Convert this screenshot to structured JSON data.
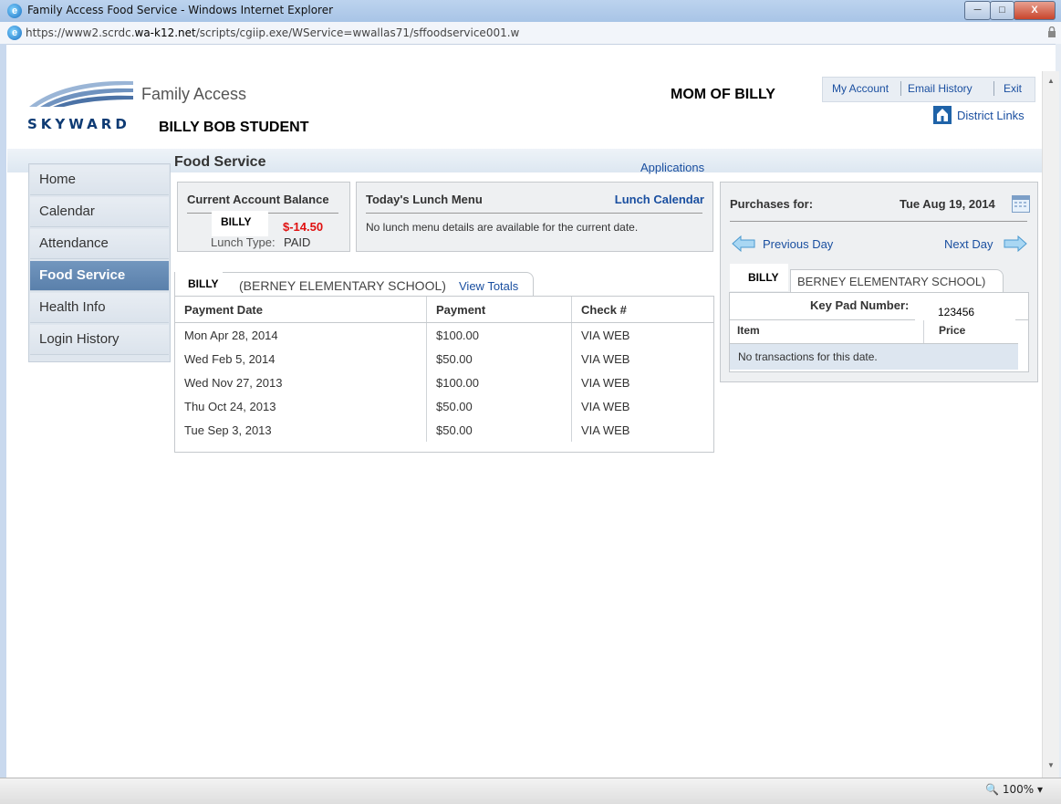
{
  "window": {
    "title": "Family Access Food Service - Windows Internet Explorer",
    "url_prefix": "https://www2.scrdc.",
    "url_domain": "wa-k12.net",
    "url_path": "/scripts/cgiip.exe/WService=wwallas71/sffoodservice001.w",
    "zoom": "100%"
  },
  "header": {
    "logo_text": "SKYWARD",
    "app_name": "Family Access",
    "student_name": "BILLY BOB STUDENT",
    "parent_name": "MOM OF BILLY",
    "links": [
      "My Account",
      "Email History",
      "Exit"
    ],
    "district_links": "District Links"
  },
  "sidebar": {
    "items": [
      {
        "label": "Home"
      },
      {
        "label": "Calendar"
      },
      {
        "label": "Attendance"
      },
      {
        "label": "Food Service"
      },
      {
        "label": "Health Info"
      },
      {
        "label": "Login History"
      }
    ]
  },
  "main": {
    "title": "Food Service",
    "applications": "Applications",
    "balance": {
      "heading": "Current Account Balance",
      "name": "BILLY",
      "amount": "$-14.50",
      "lunch_type_label": "Lunch Type:",
      "lunch_type_value": "PAID"
    },
    "menu": {
      "heading": "Today's Lunch Menu",
      "calendar_link": "Lunch Calendar",
      "message": "No lunch menu details are available for the current date."
    },
    "tab": {
      "name": "BILLY",
      "school": "(BERNEY ELEMENTARY SCHOOL)",
      "view_totals": "View Totals"
    },
    "payments": {
      "columns": [
        "Payment Date",
        "Payment",
        "Check #"
      ],
      "rows": [
        [
          "Mon Apr 28, 2014",
          "$100.00",
          "VIA WEB"
        ],
        [
          "Wed Feb 5, 2014",
          "$50.00",
          "VIA WEB"
        ],
        [
          "Wed Nov 27, 2013",
          "$100.00",
          "VIA WEB"
        ],
        [
          "Thu Oct 24, 2013",
          "$50.00",
          "VIA WEB"
        ],
        [
          "Tue Sep 3, 2013",
          "$50.00",
          "VIA WEB"
        ]
      ]
    },
    "purchases": {
      "heading": "Purchases for:",
      "date": "Tue Aug 19, 2014",
      "previous": "Previous Day",
      "next": "Next Day",
      "tab_name": "BILLY",
      "tab_school": "BERNEY ELEMENTARY SCHOOL)",
      "keypad_label": "Key Pad Number:",
      "keypad_value": "123456",
      "col_item": "Item",
      "col_price": "Price",
      "empty": "No transactions for this date."
    }
  }
}
